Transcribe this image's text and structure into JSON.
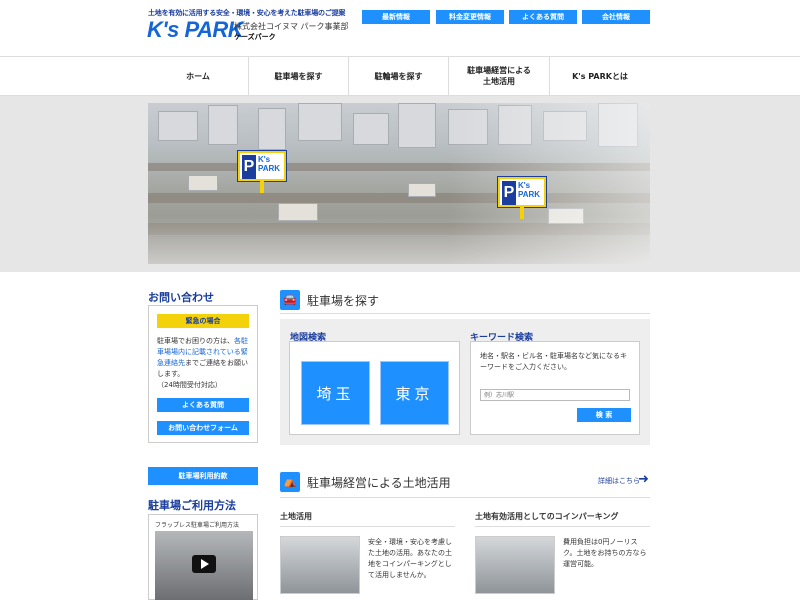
{
  "header": {
    "tagline": "土地を有効に活用する安全・環境・安心を考えた駐車場のご提案",
    "logo": "K's PARK",
    "company": "株式会社コイヌマ パーク事業部",
    "reading": "ケーズパーク",
    "top_links": [
      "最新情報",
      "料金変更情報",
      "よくある質問",
      "会社情報"
    ]
  },
  "nav": {
    "items": [
      "ホーム",
      "駐車場を探す",
      "駐輪場を探す",
      "駐車場経営による\n土地活用",
      "K's PARKとは"
    ]
  },
  "hero": {
    "pin_text": "K's\nPARK",
    "pin_letter": "P"
  },
  "sidebar": {
    "contact_title": "お問い合わせ",
    "urgent_label": "緊急の場合",
    "contact_text_pre": "駐車場でお困りの方は、",
    "contact_text_hl": "各駐車場場内に記載されている緊急連絡先",
    "contact_text_post": "までご連絡をお願いします。",
    "hours": "（24時間受付対応）",
    "faq_button": "よくある質問",
    "form_button": "お問い合わせフォーム",
    "terms_button": "駐車場利用約款",
    "usage_title": "駐車場ご利用方法",
    "video_title": "フラップレス駐車場ご利用方法"
  },
  "search": {
    "title": "駐車場を探す",
    "map_title": "地図検索",
    "prefectures": [
      "埼玉",
      "東京"
    ],
    "keyword_title": "キーワード検索",
    "keyword_desc": "地名・駅名・ビル名・駐車場名など気になるキーワードをご入力ください。",
    "placeholder": "例）志川駅",
    "search_button": "検 索"
  },
  "land": {
    "title": "駐車場経営による土地活用",
    "more_link": "詳細はこちら",
    "col1_title": "土地活用",
    "col1_text": "安全・環境・安心を考慮した土地の活用。あなたの土地をコインパーキングとして活用しませんか。",
    "col2_title": "土地有効活用としてのコインパーキング",
    "col2_text": "費用負担は0円ノーリスク。土地をお持ちの方なら運営可能。"
  },
  "colors": {
    "accent": "#1e90ff",
    "navy": "#1a3d9e",
    "yellow": "#f3d20b"
  }
}
